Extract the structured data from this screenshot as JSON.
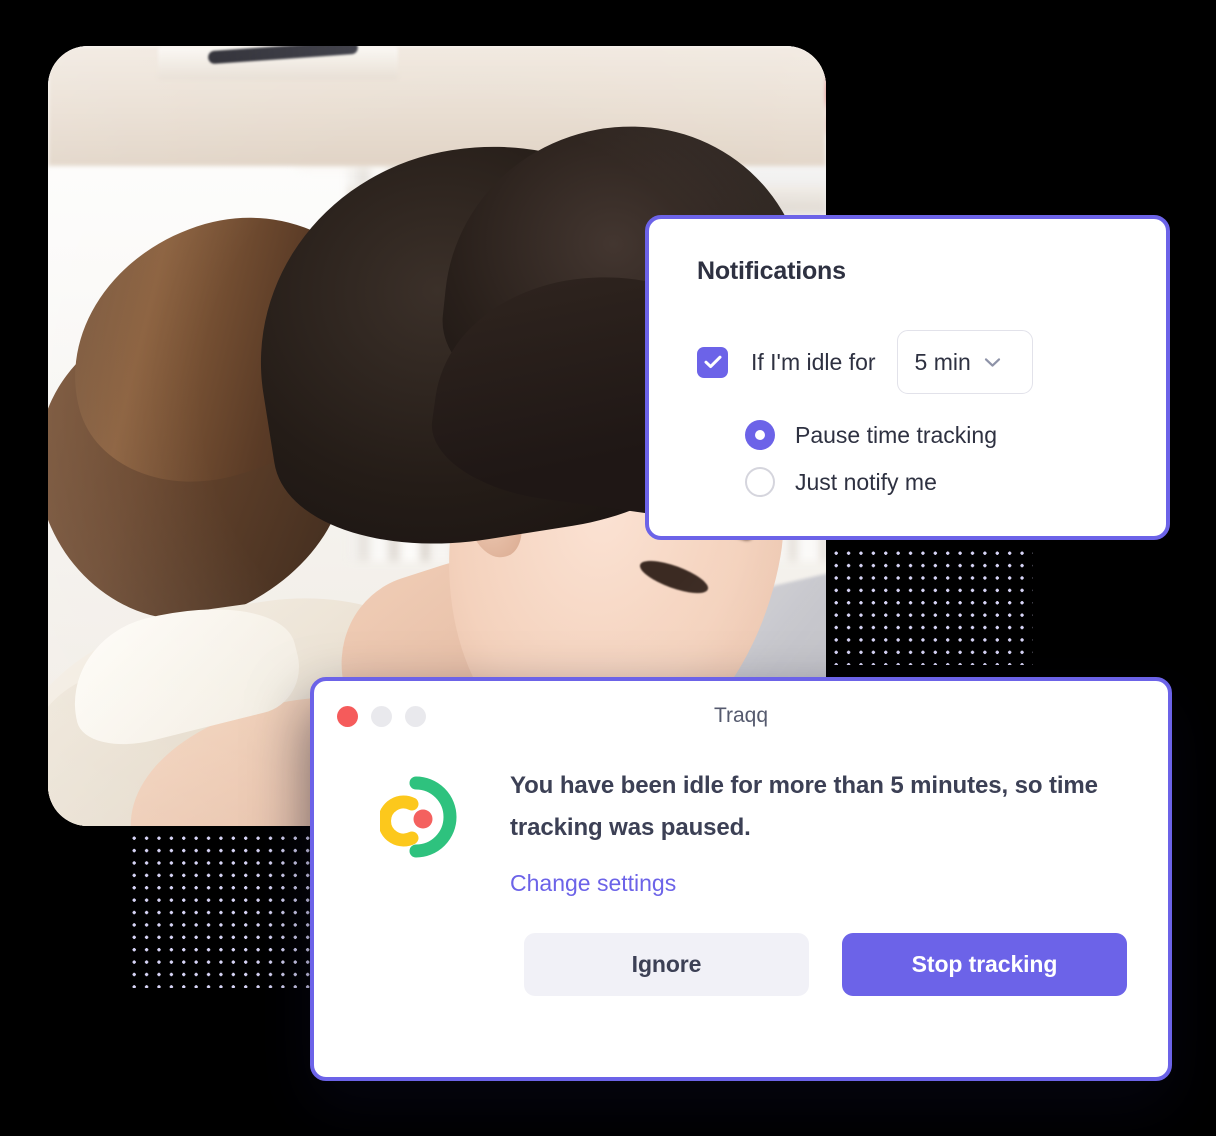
{
  "colors": {
    "accent": "#6C63E8",
    "text_dark": "#2e3141",
    "text_body": "#3c4055",
    "title_grey": "#555a6e",
    "button_light": "#f1f1f7",
    "close_red": "#F55B5B",
    "logo_red": "#F4615F",
    "logo_yellow": "#FCC81C",
    "logo_green": "#2EC27E",
    "dot_pattern": "#d8d5f7",
    "background": "#000000"
  },
  "notifications_panel": {
    "title": "Notifications",
    "idle_checkbox": {
      "label": "If I'm idle for",
      "checked": true,
      "icon": "check-icon"
    },
    "idle_duration_select": {
      "value": "5 min",
      "caret_icon": "chevron-down-icon"
    },
    "radio_options": [
      {
        "label": "Pause time tracking",
        "selected": true
      },
      {
        "label": "Just notify me",
        "selected": false
      }
    ]
  },
  "app_window": {
    "title": "Traqq",
    "traffic_lights": [
      {
        "name": "close",
        "color": "#F55B5B"
      },
      {
        "name": "minimize",
        "color": "#e9e9ed"
      },
      {
        "name": "maximize",
        "color": "#e9e9ed"
      }
    ],
    "logo_icon": "traqq-logo-icon",
    "message": "You have been idle for more than 5 minutes, so time tracking was paused.",
    "link": "Change settings",
    "buttons": {
      "secondary": "Ignore",
      "primary": "Stop tracking"
    }
  },
  "decorations": {
    "photo_alt": "woman studying at a desk with laptop in front of bookshelves",
    "dot_patterns": 2
  }
}
